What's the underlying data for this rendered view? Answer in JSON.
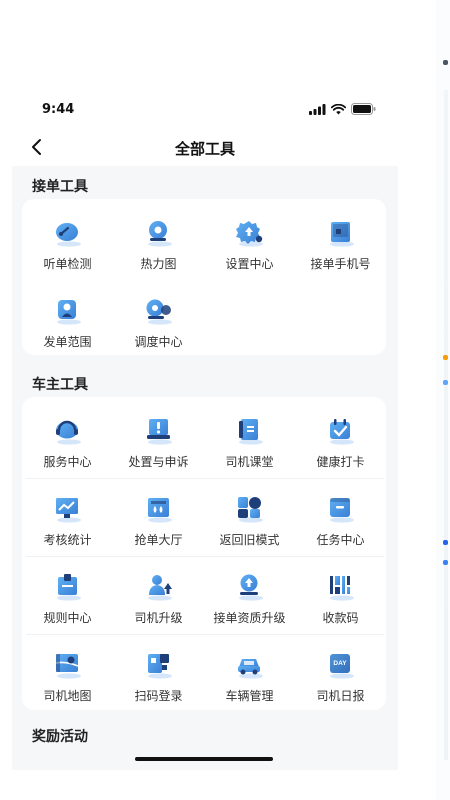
{
  "status": {
    "time": "9:44"
  },
  "header": {
    "title": "全部工具"
  },
  "sections": [
    {
      "title": "接单工具",
      "tools": [
        {
          "label": "听单检测",
          "icon": "gauge-icon"
        },
        {
          "label": "热力图",
          "icon": "location-pin-icon"
        },
        {
          "label": "设置中心",
          "icon": "gear-icon"
        },
        {
          "label": "接单手机号",
          "icon": "phone-book-icon"
        },
        {
          "label": "发单范围",
          "icon": "area-pin-icon"
        },
        {
          "label": "调度中心",
          "icon": "dispatch-icon"
        }
      ]
    },
    {
      "title": "车主工具",
      "tools": [
        {
          "label": "服务中心",
          "icon": "headset-icon"
        },
        {
          "label": "处置与申诉",
          "icon": "alert-icon"
        },
        {
          "label": "司机课堂",
          "icon": "book-icon"
        },
        {
          "label": "健康打卡",
          "icon": "calendar-check-icon"
        },
        {
          "label": "考核统计",
          "icon": "trend-chart-icon"
        },
        {
          "label": "抢单大厅",
          "icon": "grab-order-icon"
        },
        {
          "label": "返回旧模式",
          "icon": "switch-mode-icon"
        },
        {
          "label": "任务中心",
          "icon": "task-icon"
        },
        {
          "label": "规则中心",
          "icon": "rules-icon"
        },
        {
          "label": "司机升级",
          "icon": "upgrade-icon"
        },
        {
          "label": "接单资质升级",
          "icon": "qualification-icon"
        },
        {
          "label": "收款码",
          "icon": "qr-code-icon"
        },
        {
          "label": "司机地图",
          "icon": "map-icon"
        },
        {
          "label": "扫码登录",
          "icon": "scan-login-icon"
        },
        {
          "label": "车辆管理",
          "icon": "car-icon"
        },
        {
          "label": "司机日报",
          "icon": "daily-report-icon"
        }
      ]
    },
    {
      "title": "奖励活动",
      "tools": []
    }
  ],
  "icon_badges": {
    "daily-report-icon": "DAY"
  },
  "colors": {
    "icon_dark": "#1f3f7a",
    "icon_mid": "#3a7fd5",
    "icon_light": "#5fb0f3",
    "icon_shadow": "#d6e6fa",
    "bg": "#f6f7f9"
  }
}
